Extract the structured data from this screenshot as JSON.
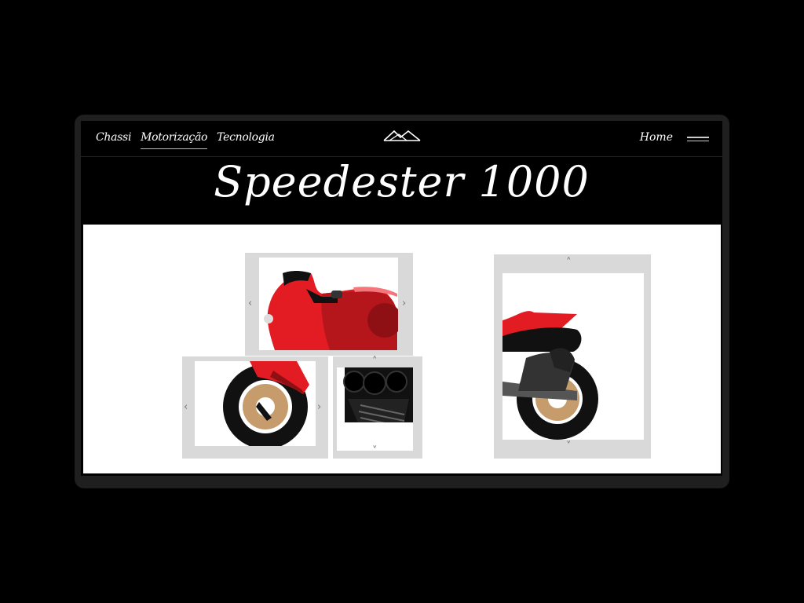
{
  "nav": {
    "links": [
      {
        "label": "Chassi",
        "active": false
      },
      {
        "label": "Motorização",
        "active": true
      },
      {
        "label": "Tecnologia",
        "active": false
      }
    ],
    "home_label": "Home",
    "logo_icon": "mountain-logo-icon",
    "menu_icon": "hamburger-menu-icon"
  },
  "hero": {
    "title": "Speedester 1000"
  },
  "puzzle": {
    "arrow_left": "‹",
    "arrow_right": "›",
    "arrow_up": "˄",
    "arrow_down": "˅",
    "colors": {
      "accent_red": "#e31b23",
      "tile_frame": "#d9d9d9",
      "tire": "#111111",
      "rim": "#c69c6d"
    }
  }
}
